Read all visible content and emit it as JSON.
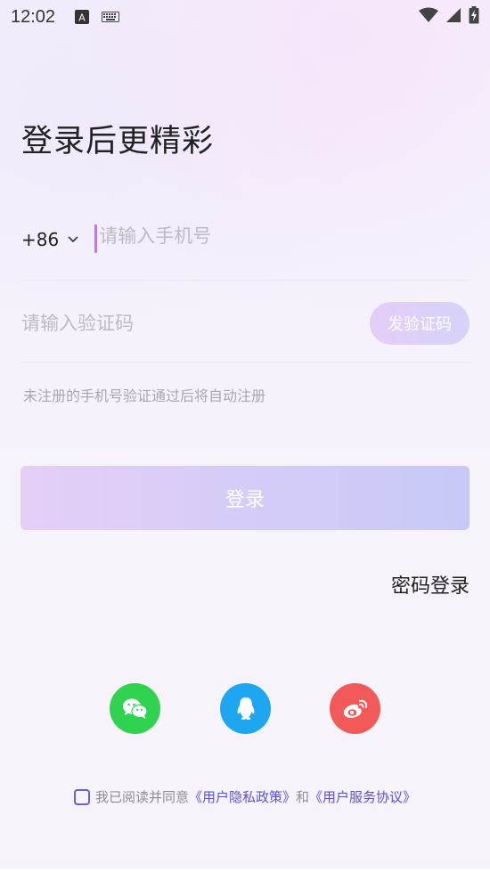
{
  "status": {
    "time": "12:02",
    "icons": [
      "a-icon",
      "keyboard-icon",
      "wifi-icon",
      "signal-icon",
      "battery-charging-icon"
    ]
  },
  "title": "登录后更精彩",
  "phone": {
    "country_code": "+86",
    "placeholder": "请输入手机号"
  },
  "code": {
    "placeholder": "请输入验证码",
    "send_label": "发验证码"
  },
  "hint": "未注册的手机号验证通过后将自动注册",
  "login_label": "登录",
  "password_login_label": "密码登录",
  "social": [
    "wechat-icon",
    "qq-icon",
    "weibo-icon"
  ],
  "agreement": {
    "prefix": "我已阅读并同意",
    "privacy": "《用户隐私政策》",
    "and": "和",
    "service": "《用户服务协议》"
  },
  "colors": {
    "accent": "#b47ee8",
    "wechat": "#2fd34f",
    "qq": "#1ea7f0",
    "weibo": "#f25a59",
    "link": "#5a52d4"
  }
}
